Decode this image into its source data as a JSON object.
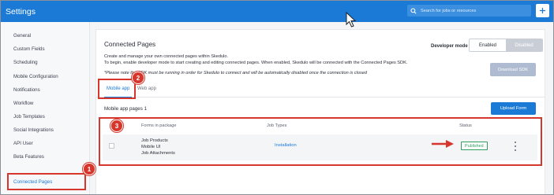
{
  "header": {
    "title": "Settings",
    "search_placeholder": "Search for jobs or resources",
    "icons": [
      "search-icon",
      "plus-icon"
    ]
  },
  "sidebar": {
    "items": [
      {
        "label": "General"
      },
      {
        "label": "Custom Fields"
      },
      {
        "label": "Scheduling"
      },
      {
        "label": "Mobile Configuration"
      },
      {
        "label": "Notifications"
      },
      {
        "label": "Workflow"
      },
      {
        "label": "Job Templates"
      },
      {
        "label": "Social Integrations"
      },
      {
        "label": "API User"
      },
      {
        "label": "Beta Features"
      },
      {
        "label": "Connected Pages",
        "active": true
      }
    ]
  },
  "callouts": [
    "1",
    "2",
    "3"
  ],
  "main": {
    "title": "Connected Pages",
    "description_line1": "Create and manage your own connected pages within Skedulo.",
    "description_line2": "To begin, enable developer mode to start creating and editing connected pages. When enabled, Skedulo will be connected with the Connected Pages SDK.",
    "note": "*Please note the SDK must be running in order for Skedulo to connect and will be automatically disabled once the connection is closed",
    "developer_mode": {
      "label": "Developer mode",
      "options": [
        "Enabled",
        "Disabled"
      ],
      "selected": "Disabled"
    },
    "download_sdk_label": "Download SDK",
    "tabs": [
      {
        "label": "Mobile app",
        "active": true
      },
      {
        "label": "Web app",
        "active": false
      }
    ],
    "subhead": "Mobile app pages 1",
    "upload_form_label": "Upload Form",
    "table": {
      "headers": [
        "Forms in package",
        "Job Types",
        "Status"
      ],
      "rows": [
        {
          "forms": [
            "Job Products",
            "Mobile UI",
            "Job Attachments"
          ],
          "job_type": "Installation",
          "status": "Published"
        }
      ]
    }
  },
  "colors": {
    "brand_blue": "#1b7ad6",
    "annotation_red": "#d6362b",
    "status_green": "#2e9d5e"
  }
}
